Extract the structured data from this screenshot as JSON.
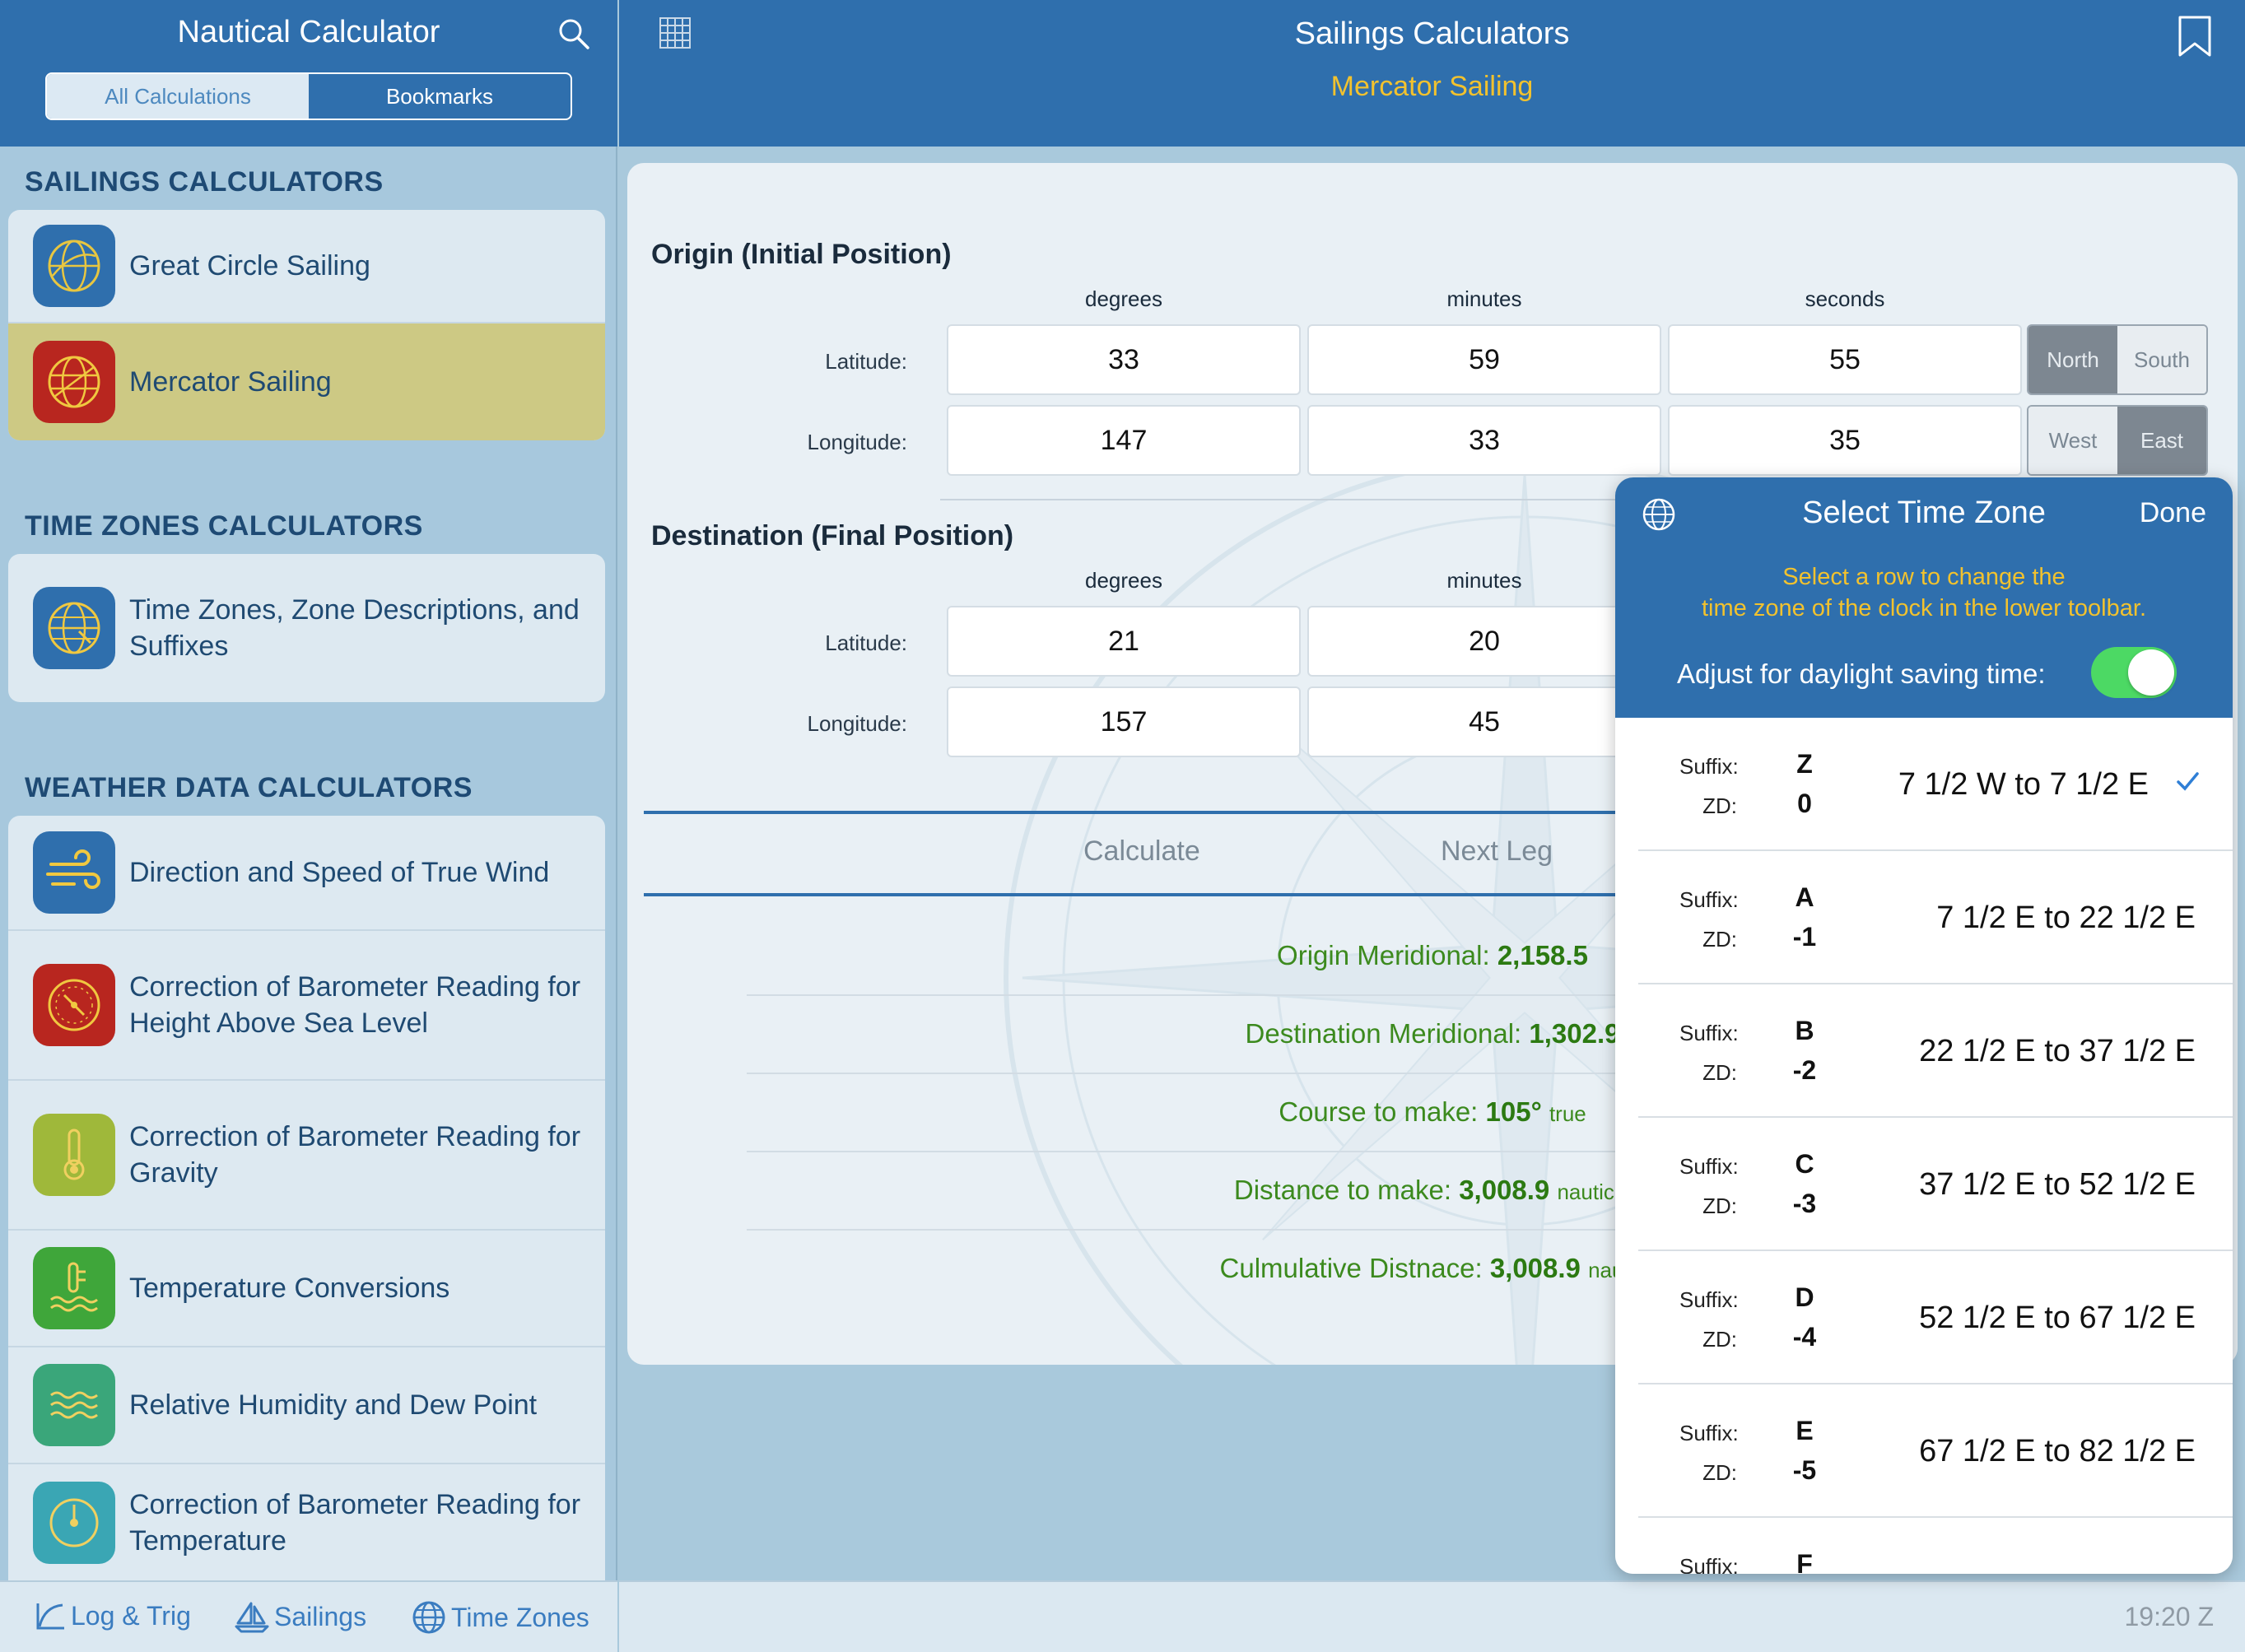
{
  "sidebar": {
    "title": "Nautical Calculator",
    "segments": [
      "All Calculations",
      "Bookmarks"
    ],
    "sections": [
      {
        "title": "SAILINGS CALCULATORS",
        "items": [
          "Great Circle Sailing",
          "Mercator Sailing"
        ]
      },
      {
        "title": "TIME ZONES CALCULATORS",
        "items": [
          "Time Zones, Zone Descriptions, and Suffixes"
        ]
      },
      {
        "title": "WEATHER DATA CALCULATORS",
        "items": [
          "Direction and Speed of True Wind",
          "Correction of Barometer Reading for Height Above Sea Level",
          "Correction of Barometer Reading for Gravity",
          "Temperature Conversions",
          "Relative Humidity and Dew Point",
          "Correction of Barometer Reading for Temperature"
        ]
      }
    ],
    "selected_item": "Mercator Sailing"
  },
  "header": {
    "title": "Sailings Calculators",
    "subtitle": "Mercator Sailing"
  },
  "origin": {
    "title": "Origin (Initial Position)",
    "columns": [
      "degrees",
      "minutes",
      "seconds"
    ],
    "latitude_label": "Latitude:",
    "longitude_label": "Longitude:",
    "latitude": {
      "degrees": "33",
      "minutes": "59",
      "seconds": "55",
      "hemisphere_options": [
        "North",
        "South"
      ],
      "selected": "North"
    },
    "longitude": {
      "degrees": "147",
      "minutes": "33",
      "seconds": "35",
      "hemisphere_options": [
        "West",
        "East"
      ],
      "selected": "East"
    }
  },
  "destination": {
    "title": "Destination (Final Position)",
    "columns": [
      "degrees",
      "minutes"
    ],
    "latitude_label": "Latitude:",
    "longitude_label": "Longitude:",
    "latitude": {
      "degrees": "21",
      "minutes": "20"
    },
    "longitude": {
      "degrees": "157",
      "minutes": "45"
    }
  },
  "buttons": {
    "calculate": "Calculate",
    "next_leg": "Next Leg"
  },
  "results": [
    {
      "label": "Origin Meridional:",
      "value": "2,158.5",
      "unit": ""
    },
    {
      "label": "Destination Meridional:",
      "value": "1,302.9",
      "unit": ""
    },
    {
      "label": "Course to make:",
      "value": "105°",
      "unit": "true"
    },
    {
      "label": "Distance to make:",
      "value": "3,008.9",
      "unit": "nautical"
    },
    {
      "label": "Culmulative Distnace:",
      "value": "3,008.9",
      "unit": "nautic"
    }
  ],
  "toolbar": {
    "items": [
      "Log & Trig",
      "Sailings",
      "Time Zones"
    ],
    "clock": "19:20 Z"
  },
  "timezone_popover": {
    "title": "Select Time Zone",
    "done": "Done",
    "hint": "Select a row to change the time zone of the clock in the lower toolbar.",
    "hint_line1": "Select a row to change the",
    "hint_line2": "time zone of the clock in the lower toolbar.",
    "dst_label": "Adjust for daylight saving time:",
    "dst_on": true,
    "suffix_label": "Suffix:",
    "zd_label": "ZD:",
    "rows": [
      {
        "suffix": "Z",
        "zd": "0",
        "range": "7 1/2 W to 7 1/2 E",
        "selected": true
      },
      {
        "suffix": "A",
        "zd": "-1",
        "range": "7 1/2 E to 22 1/2 E"
      },
      {
        "suffix": "B",
        "zd": "-2",
        "range": "22 1/2 E to 37 1/2 E"
      },
      {
        "suffix": "C",
        "zd": "-3",
        "range": "37 1/2 E to 52 1/2 E"
      },
      {
        "suffix": "D",
        "zd": "-4",
        "range": "52 1/2 E to 67 1/2 E"
      },
      {
        "suffix": "E",
        "zd": "-5",
        "range": "67 1/2 E to 82 1/2 E"
      },
      {
        "suffix": "F",
        "zd": "",
        "range": ""
      }
    ]
  },
  "colors": {
    "header_blue": "#2f6fad",
    "accent_yellow": "#f2c22e",
    "result_green": "#3c8a1e",
    "selected_row": "#cdc984"
  },
  "icons": {
    "search": "search-icon",
    "grid": "grid-icon",
    "bookmark": "bookmark-icon",
    "globe": "globe-icon",
    "great_circle": "globe-sphere-icon",
    "mercator": "mercator-globe-icon",
    "time_zones": "clock-globe-icon",
    "true_wind": "wind-icon",
    "barometer_height": "barometer-dial-icon",
    "barometer_gravity": "thermometer-icon",
    "temperature": "thermometer-waves-icon",
    "humidity": "humidity-waves-icon",
    "barometer_temperature": "gauge-icon"
  }
}
